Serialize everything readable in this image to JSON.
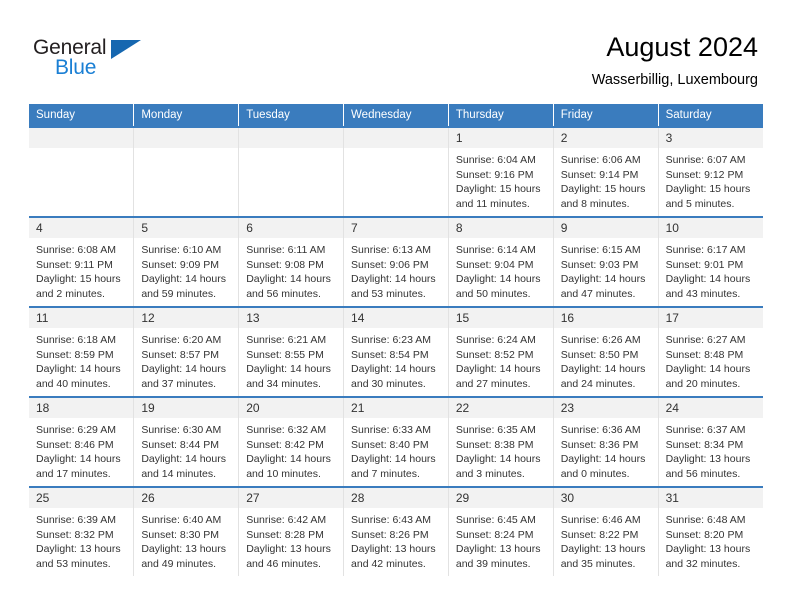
{
  "brand": {
    "name_top": "General",
    "name_bottom": "Blue",
    "color_top": "#231f20",
    "color_bottom": "#1a7fd4",
    "triangle_color": "#1667b0"
  },
  "header": {
    "title": "August 2024",
    "subtitle": "Wasserbillig, Luxembourg"
  },
  "theme": {
    "header_bg": "#3a7cbe",
    "header_text": "#ffffff",
    "daynum_bg": "#f2f2f2",
    "cell_text": "#333333"
  },
  "weekdays": [
    "Sunday",
    "Monday",
    "Tuesday",
    "Wednesday",
    "Thursday",
    "Friday",
    "Saturday"
  ],
  "weeks": [
    [
      {
        "day": "",
        "sunrise": "",
        "sunset": "",
        "daylight_1": "",
        "daylight_2": ""
      },
      {
        "day": "",
        "sunrise": "",
        "sunset": "",
        "daylight_1": "",
        "daylight_2": ""
      },
      {
        "day": "",
        "sunrise": "",
        "sunset": "",
        "daylight_1": "",
        "daylight_2": ""
      },
      {
        "day": "",
        "sunrise": "",
        "sunset": "",
        "daylight_1": "",
        "daylight_2": ""
      },
      {
        "day": "1",
        "sunrise": "Sunrise: 6:04 AM",
        "sunset": "Sunset: 9:16 PM",
        "daylight_1": "Daylight: 15 hours",
        "daylight_2": "and 11 minutes."
      },
      {
        "day": "2",
        "sunrise": "Sunrise: 6:06 AM",
        "sunset": "Sunset: 9:14 PM",
        "daylight_1": "Daylight: 15 hours",
        "daylight_2": "and 8 minutes."
      },
      {
        "day": "3",
        "sunrise": "Sunrise: 6:07 AM",
        "sunset": "Sunset: 9:12 PM",
        "daylight_1": "Daylight: 15 hours",
        "daylight_2": "and 5 minutes."
      }
    ],
    [
      {
        "day": "4",
        "sunrise": "Sunrise: 6:08 AM",
        "sunset": "Sunset: 9:11 PM",
        "daylight_1": "Daylight: 15 hours",
        "daylight_2": "and 2 minutes."
      },
      {
        "day": "5",
        "sunrise": "Sunrise: 6:10 AM",
        "sunset": "Sunset: 9:09 PM",
        "daylight_1": "Daylight: 14 hours",
        "daylight_2": "and 59 minutes."
      },
      {
        "day": "6",
        "sunrise": "Sunrise: 6:11 AM",
        "sunset": "Sunset: 9:08 PM",
        "daylight_1": "Daylight: 14 hours",
        "daylight_2": "and 56 minutes."
      },
      {
        "day": "7",
        "sunrise": "Sunrise: 6:13 AM",
        "sunset": "Sunset: 9:06 PM",
        "daylight_1": "Daylight: 14 hours",
        "daylight_2": "and 53 minutes."
      },
      {
        "day": "8",
        "sunrise": "Sunrise: 6:14 AM",
        "sunset": "Sunset: 9:04 PM",
        "daylight_1": "Daylight: 14 hours",
        "daylight_2": "and 50 minutes."
      },
      {
        "day": "9",
        "sunrise": "Sunrise: 6:15 AM",
        "sunset": "Sunset: 9:03 PM",
        "daylight_1": "Daylight: 14 hours",
        "daylight_2": "and 47 minutes."
      },
      {
        "day": "10",
        "sunrise": "Sunrise: 6:17 AM",
        "sunset": "Sunset: 9:01 PM",
        "daylight_1": "Daylight: 14 hours",
        "daylight_2": "and 43 minutes."
      }
    ],
    [
      {
        "day": "11",
        "sunrise": "Sunrise: 6:18 AM",
        "sunset": "Sunset: 8:59 PM",
        "daylight_1": "Daylight: 14 hours",
        "daylight_2": "and 40 minutes."
      },
      {
        "day": "12",
        "sunrise": "Sunrise: 6:20 AM",
        "sunset": "Sunset: 8:57 PM",
        "daylight_1": "Daylight: 14 hours",
        "daylight_2": "and 37 minutes."
      },
      {
        "day": "13",
        "sunrise": "Sunrise: 6:21 AM",
        "sunset": "Sunset: 8:55 PM",
        "daylight_1": "Daylight: 14 hours",
        "daylight_2": "and 34 minutes."
      },
      {
        "day": "14",
        "sunrise": "Sunrise: 6:23 AM",
        "sunset": "Sunset: 8:54 PM",
        "daylight_1": "Daylight: 14 hours",
        "daylight_2": "and 30 minutes."
      },
      {
        "day": "15",
        "sunrise": "Sunrise: 6:24 AM",
        "sunset": "Sunset: 8:52 PM",
        "daylight_1": "Daylight: 14 hours",
        "daylight_2": "and 27 minutes."
      },
      {
        "day": "16",
        "sunrise": "Sunrise: 6:26 AM",
        "sunset": "Sunset: 8:50 PM",
        "daylight_1": "Daylight: 14 hours",
        "daylight_2": "and 24 minutes."
      },
      {
        "day": "17",
        "sunrise": "Sunrise: 6:27 AM",
        "sunset": "Sunset: 8:48 PM",
        "daylight_1": "Daylight: 14 hours",
        "daylight_2": "and 20 minutes."
      }
    ],
    [
      {
        "day": "18",
        "sunrise": "Sunrise: 6:29 AM",
        "sunset": "Sunset: 8:46 PM",
        "daylight_1": "Daylight: 14 hours",
        "daylight_2": "and 17 minutes."
      },
      {
        "day": "19",
        "sunrise": "Sunrise: 6:30 AM",
        "sunset": "Sunset: 8:44 PM",
        "daylight_1": "Daylight: 14 hours",
        "daylight_2": "and 14 minutes."
      },
      {
        "day": "20",
        "sunrise": "Sunrise: 6:32 AM",
        "sunset": "Sunset: 8:42 PM",
        "daylight_1": "Daylight: 14 hours",
        "daylight_2": "and 10 minutes."
      },
      {
        "day": "21",
        "sunrise": "Sunrise: 6:33 AM",
        "sunset": "Sunset: 8:40 PM",
        "daylight_1": "Daylight: 14 hours",
        "daylight_2": "and 7 minutes."
      },
      {
        "day": "22",
        "sunrise": "Sunrise: 6:35 AM",
        "sunset": "Sunset: 8:38 PM",
        "daylight_1": "Daylight: 14 hours",
        "daylight_2": "and 3 minutes."
      },
      {
        "day": "23",
        "sunrise": "Sunrise: 6:36 AM",
        "sunset": "Sunset: 8:36 PM",
        "daylight_1": "Daylight: 14 hours",
        "daylight_2": "and 0 minutes."
      },
      {
        "day": "24",
        "sunrise": "Sunrise: 6:37 AM",
        "sunset": "Sunset: 8:34 PM",
        "daylight_1": "Daylight: 13 hours",
        "daylight_2": "and 56 minutes."
      }
    ],
    [
      {
        "day": "25",
        "sunrise": "Sunrise: 6:39 AM",
        "sunset": "Sunset: 8:32 PM",
        "daylight_1": "Daylight: 13 hours",
        "daylight_2": "and 53 minutes."
      },
      {
        "day": "26",
        "sunrise": "Sunrise: 6:40 AM",
        "sunset": "Sunset: 8:30 PM",
        "daylight_1": "Daylight: 13 hours",
        "daylight_2": "and 49 minutes."
      },
      {
        "day": "27",
        "sunrise": "Sunrise: 6:42 AM",
        "sunset": "Sunset: 8:28 PM",
        "daylight_1": "Daylight: 13 hours",
        "daylight_2": "and 46 minutes."
      },
      {
        "day": "28",
        "sunrise": "Sunrise: 6:43 AM",
        "sunset": "Sunset: 8:26 PM",
        "daylight_1": "Daylight: 13 hours",
        "daylight_2": "and 42 minutes."
      },
      {
        "day": "29",
        "sunrise": "Sunrise: 6:45 AM",
        "sunset": "Sunset: 8:24 PM",
        "daylight_1": "Daylight: 13 hours",
        "daylight_2": "and 39 minutes."
      },
      {
        "day": "30",
        "sunrise": "Sunrise: 6:46 AM",
        "sunset": "Sunset: 8:22 PM",
        "daylight_1": "Daylight: 13 hours",
        "daylight_2": "and 35 minutes."
      },
      {
        "day": "31",
        "sunrise": "Sunrise: 6:48 AM",
        "sunset": "Sunset: 8:20 PM",
        "daylight_1": "Daylight: 13 hours",
        "daylight_2": "and 32 minutes."
      }
    ]
  ]
}
